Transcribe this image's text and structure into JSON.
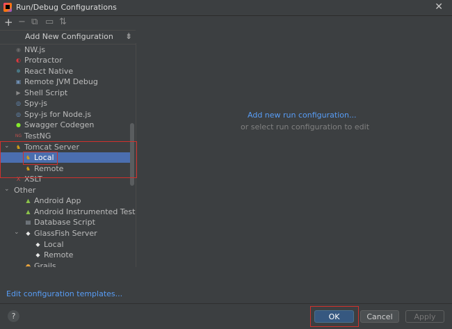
{
  "window": {
    "title": "Run/Debug Configurations",
    "close_glyph": "✕"
  },
  "toolbar": {
    "items": [
      {
        "icon": "add-icon",
        "glyph": "+"
      },
      {
        "icon": "remove-icon",
        "glyph": "−"
      },
      {
        "icon": "copy-icon",
        "glyph": "⧉"
      },
      {
        "icon": "folder-icon",
        "glyph": "▭"
      },
      {
        "icon": "sort-icon",
        "glyph": "⇅"
      }
    ]
  },
  "add_new_configuration": {
    "label": "Add New Configuration",
    "icon_glyph": "⇟"
  },
  "tree": [
    {
      "label": "NW.js",
      "icon": "nwjs-icon",
      "color": "#6b6b6b",
      "glyph": "◉"
    },
    {
      "label": "Protractor",
      "icon": "protractor-icon",
      "color": "#e0383e",
      "glyph": "◐"
    },
    {
      "label": "React Native",
      "icon": "react-icon",
      "color": "#61dafb",
      "glyph": "⚛"
    },
    {
      "label": "Remote JVM Debug",
      "icon": "remote-debug-icon",
      "color": "#6f8fb4",
      "glyph": "▣"
    },
    {
      "label": "Shell Script",
      "icon": "shell-script-icon",
      "color": "#8a8a8a",
      "glyph": "▶"
    },
    {
      "label": "Spy-js",
      "icon": "spyjs-icon",
      "color": "#6a95c7",
      "glyph": "◎"
    },
    {
      "label": "Spy-js for Node.js",
      "icon": "spyjs-node-icon",
      "color": "#6a95c7",
      "glyph": "◎"
    },
    {
      "label": "Swagger Codegen",
      "icon": "swagger-icon",
      "color": "#85ea2d",
      "glyph": "●"
    },
    {
      "label": "TestNG",
      "icon": "testng-icon",
      "color": "#c0504d",
      "glyph": "NG"
    },
    {
      "label": "Tomcat Server",
      "icon": "tomcat-icon",
      "color": "#d4a017",
      "glyph": "♞",
      "expanded": true
    },
    {
      "label": "Local",
      "icon": "tomcat-icon",
      "color": "#d4a017",
      "glyph": "♞",
      "selected": true
    },
    {
      "label": "Remote",
      "icon": "tomcat-icon",
      "color": "#d4a017",
      "glyph": "♞"
    },
    {
      "label": "XSLT",
      "icon": "xslt-icon",
      "color": "#c0504d",
      "glyph": "X"
    },
    {
      "label": "Other",
      "icon": "",
      "color": "",
      "glyph": "",
      "expanded": true
    },
    {
      "label": "Android App",
      "icon": "android-icon",
      "color": "#8bc34a",
      "glyph": "▲"
    },
    {
      "label": "Android Instrumented Tests",
      "icon": "android-icon",
      "color": "#8bc34a",
      "glyph": "▲"
    },
    {
      "label": "Database Script",
      "icon": "database-icon",
      "color": "#9aa3ad",
      "glyph": "▤"
    },
    {
      "label": "GlassFish Server",
      "icon": "glassfish-icon",
      "color": "#e8e8e8",
      "glyph": "◆",
      "expanded": true
    },
    {
      "label": "Local",
      "icon": "glassfish-icon",
      "color": "#e8e8e8",
      "glyph": "◆"
    },
    {
      "label": "Remote",
      "icon": "glassfish-icon",
      "color": "#e8e8e8",
      "glyph": "◆"
    },
    {
      "label": "Grails",
      "icon": "grails-icon",
      "color": "#e8a33d",
      "glyph": "◓"
    }
  ],
  "edit_templates": "Edit configuration templates...",
  "main": {
    "add_run_link": "Add new run configuration...",
    "hint": "or select run configuration to edit"
  },
  "buttons": {
    "help": "?",
    "ok": "OK",
    "cancel": "Cancel",
    "apply": "Apply"
  },
  "colors": {
    "background": "#3c3f41",
    "selection": "#4b6eaf",
    "link": "#589df6",
    "highlight_box": "#d0312d"
  }
}
